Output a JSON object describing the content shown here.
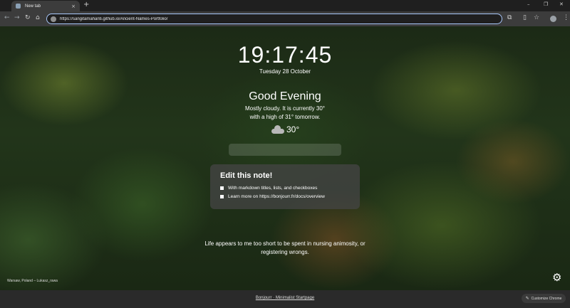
{
  "browser": {
    "tab_title": "New tab",
    "tab_close": "×",
    "new_tab": "+",
    "url": "https://sangitamahanti.github.io/Ancient-Names-Portfolio/",
    "nav_back": "←",
    "nav_forward": "→",
    "nav_reload": "↻",
    "nav_home": "⌂",
    "win_minimize": "–",
    "win_restore": "❐",
    "win_close": "✕",
    "tb_extensions": "⧉",
    "tb_sidebar": "▯",
    "tb_star": "☆",
    "tb_menu": "⋮"
  },
  "page": {
    "time": "19:17:45",
    "date": "Tuesday 28 October",
    "greeting": "Good Evening",
    "weather_line1": "Mostly cloudy. It is currently 30°",
    "weather_line2": "with a high of 31° tomorrow.",
    "temperature": "30°",
    "note": {
      "title": "Edit this note!",
      "items": [
        "With markdown titles, lists, and checkboxes",
        "Learn more on https://bonjourr.fr/docs/overview"
      ]
    },
    "quote_line1": "Life appears to me too short to be spent in nursing animosity, or",
    "quote_line2": "registering wrongs.",
    "photo_credit": "Warsaw, Poland – Lukasz_rawa",
    "settings_icon": "⚙"
  },
  "footer": {
    "link": "Bonjourr · Minimalist Startpage",
    "customize": "Customize Chrome",
    "customize_icon": "✎"
  },
  "colors": {
    "chrome_dark": "#1f1f1f",
    "toolbar": "#3c3c3c",
    "omnibox_focus": "#a8c7fa"
  }
}
